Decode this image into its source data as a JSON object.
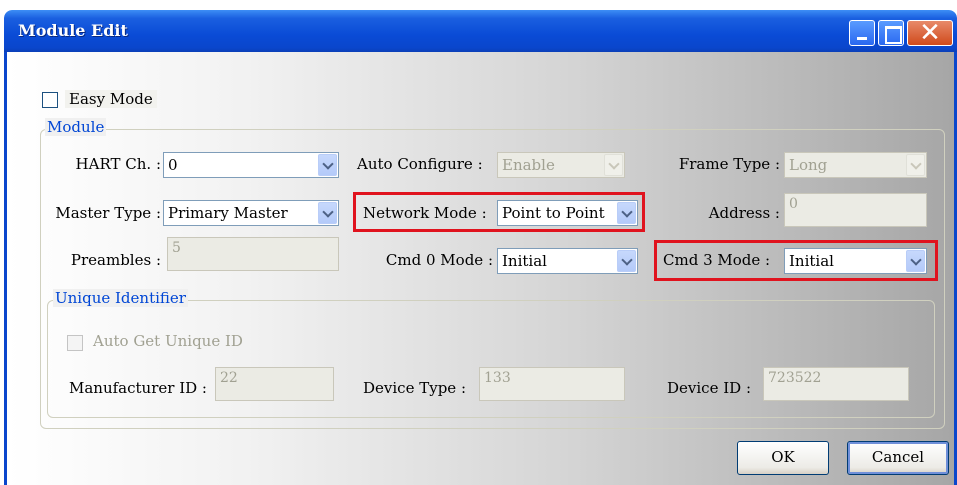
{
  "window": {
    "title": "Module Edit"
  },
  "easy_mode": {
    "label": "Easy Mode",
    "checked": false
  },
  "module": {
    "legend": "Module",
    "hart_ch": {
      "label": "HART Ch. :",
      "value": "0"
    },
    "auto_configure": {
      "label": "Auto Configure :",
      "value": "Enable"
    },
    "frame_type": {
      "label": "Frame Type :",
      "value": "Long"
    },
    "master_type": {
      "label": "Master Type :",
      "value": "Primary Master"
    },
    "network_mode": {
      "label": "Network Mode :",
      "value": "Point to Point"
    },
    "address": {
      "label": "Address :",
      "value": "0"
    },
    "preambles": {
      "label": "Preambles :",
      "value": "5"
    },
    "cmd0_mode": {
      "label": "Cmd 0 Mode :",
      "value": "Initial"
    },
    "cmd3_mode": {
      "label": "Cmd 3 Mode :",
      "value": "Initial"
    }
  },
  "unique_identifier": {
    "legend": "Unique Identifier",
    "auto_get": {
      "label": "Auto Get Unique ID",
      "checked": false
    },
    "manufacturer_id": {
      "label": "Manufacturer ID :",
      "value": "22"
    },
    "device_type": {
      "label": "Device Type :",
      "value": "133"
    },
    "device_id": {
      "label": "Device ID :",
      "value": "723522"
    }
  },
  "buttons": {
    "ok": "OK",
    "cancel": "Cancel"
  },
  "colors": {
    "highlight": "#e0131e",
    "title_bar": "#0a46cc",
    "legend_text": "#0046d5"
  }
}
